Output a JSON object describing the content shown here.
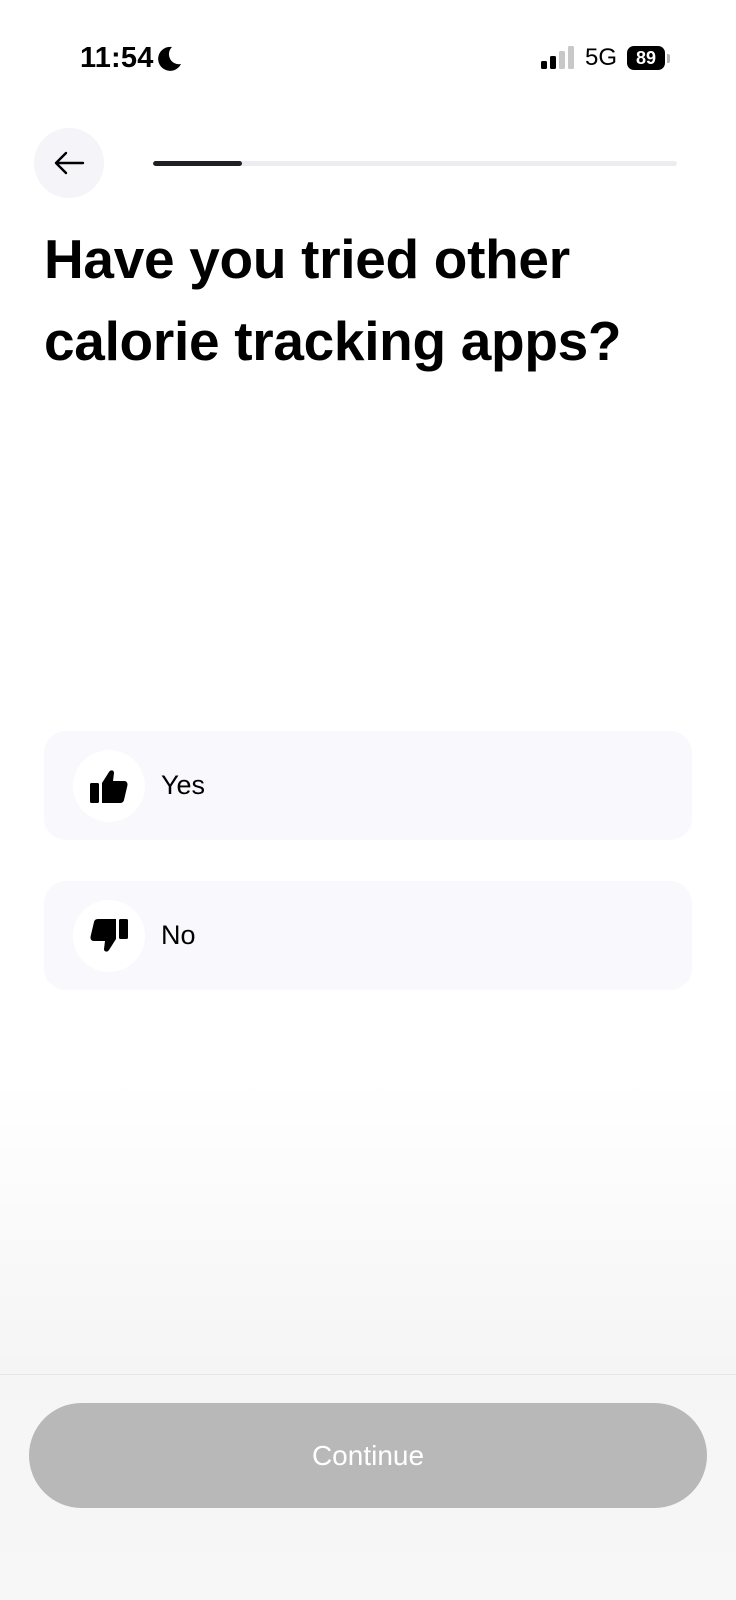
{
  "status_bar": {
    "time": "11:54",
    "network": "5G",
    "battery": "89",
    "icons": [
      "moon-icon",
      "signal-icon"
    ]
  },
  "header": {
    "back_icon": "arrow-left-icon",
    "progress_fraction": 0.17
  },
  "question": {
    "title": "Have you tried other calorie tracking apps?"
  },
  "options": [
    {
      "label": "Yes",
      "icon": "thumbs-up-icon"
    },
    {
      "label": "No",
      "icon": "thumbs-down-icon"
    }
  ],
  "footer": {
    "continue_label": "Continue",
    "button_state": "disabled"
  },
  "colors": {
    "primary_text": "#000000",
    "progress_active": "#1f1f24",
    "progress_track": "#ededf0",
    "option_bg": "#f8f8fd",
    "disabled_button": "#b8b8b8"
  }
}
